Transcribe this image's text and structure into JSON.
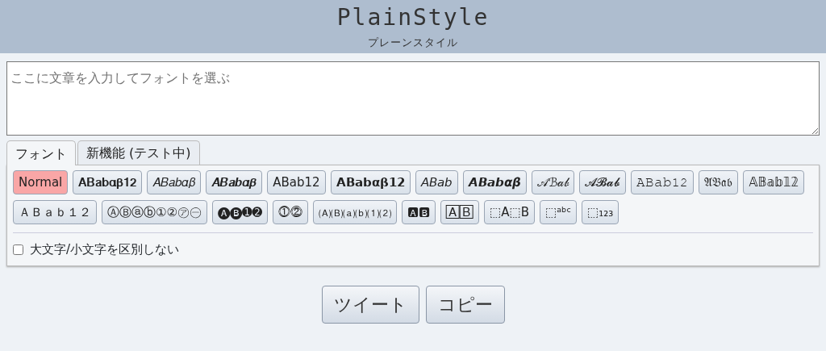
{
  "header": {
    "title": "PlainStyle",
    "subtitle": "プレーンスタイル"
  },
  "input": {
    "placeholder": "ここに文章を入力してフォントを選ぶ"
  },
  "tabs": [
    {
      "label": "フォント",
      "selected": true
    },
    {
      "label": "新機能 (テスト中)",
      "selected": false
    }
  ],
  "fonts": [
    {
      "label": "Normal",
      "selected": true
    },
    {
      "label": "𝐀𝐁𝐚𝐛𝛂𝛃𝟏𝟐",
      "selected": false
    },
    {
      "label": "𝐴𝐵𝑎𝑏𝛼𝛽",
      "selected": false
    },
    {
      "label": "𝑨𝑩𝒂𝒃𝜶𝜷",
      "selected": false
    },
    {
      "label": "𝖠𝖡𝖺𝖻𝟣𝟤",
      "selected": false
    },
    {
      "label": "𝗔𝗕𝗮𝗯𝝰𝝱𝟭𝟮",
      "selected": false
    },
    {
      "label": "𝘈𝘉𝘢𝘣",
      "selected": false
    },
    {
      "label": "𝘼𝘽𝙖𝙗𝞪𝞫",
      "selected": false
    },
    {
      "label": "𝒜ℬ𝒶𝒷",
      "selected": false
    },
    {
      "label": "𝓐𝓑𝓪𝓫",
      "selected": false
    },
    {
      "label": "𝙰𝙱𝚊𝚋𝟷𝟸",
      "selected": false
    },
    {
      "label": "𝔄𝔅𝔞𝔟",
      "selected": false
    },
    {
      "label": "𝔸𝔹𝕒𝕓𝟙𝟚",
      "selected": false
    },
    {
      "label": "ＡＢａｂ１２",
      "selected": false
    },
    {
      "label": "ⒶⒷⓐⓑ①②㋐㊀",
      "selected": false
    },
    {
      "label": "🅐🅑➊➋",
      "selected": false
    },
    {
      "label": "⓵⓶",
      "selected": false
    },
    {
      "label": "🄐🄑⒜⒝⑴⑵",
      "selected": false
    },
    {
      "label": "🅰🅱",
      "selected": false
    },
    {
      "label": "🄰🄱",
      "selected": false
    },
    {
      "label": "⬚A⬚B",
      "selected": false
    },
    {
      "label": "⬚ᵃᵇᶜ",
      "selected": false
    },
    {
      "label": "⬚₁₂₃",
      "selected": false
    }
  ],
  "case_option": {
    "label": "大文字/小文字を区別しない",
    "checked": false
  },
  "buttons": [
    "ツイート",
    "コピー"
  ]
}
